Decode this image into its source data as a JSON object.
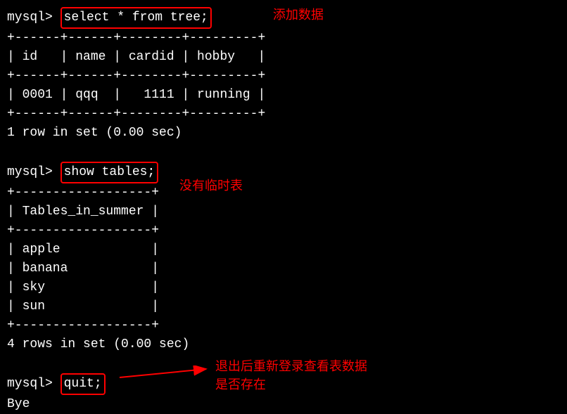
{
  "prompt": "mysql> ",
  "cmd1": "select * from tree;",
  "annotation1": "添加数据",
  "table1_sep": "+------+------+--------+---------+",
  "table1_header": "| id   | name | cardid | hobby   |",
  "table1_row1": "| 0001 | qqq  |   1111 | running |",
  "result1": "1 row in set (0.00 sec)",
  "cmd2": "show tables;",
  "annotation2": "没有临时表",
  "table2_sep": "+------------------+",
  "table2_header": "| Tables_in_summer |",
  "table2_row1": "| apple            |",
  "table2_row2": "| banana           |",
  "table2_row3": "| sky              |",
  "table2_row4": "| sun              |",
  "result2": "4 rows in set (0.00 sec)",
  "cmd3": "quit;",
  "annotation3_line1": "退出后重新登录查看表数据",
  "annotation3_line2": "是否存在",
  "bye": "Bye"
}
